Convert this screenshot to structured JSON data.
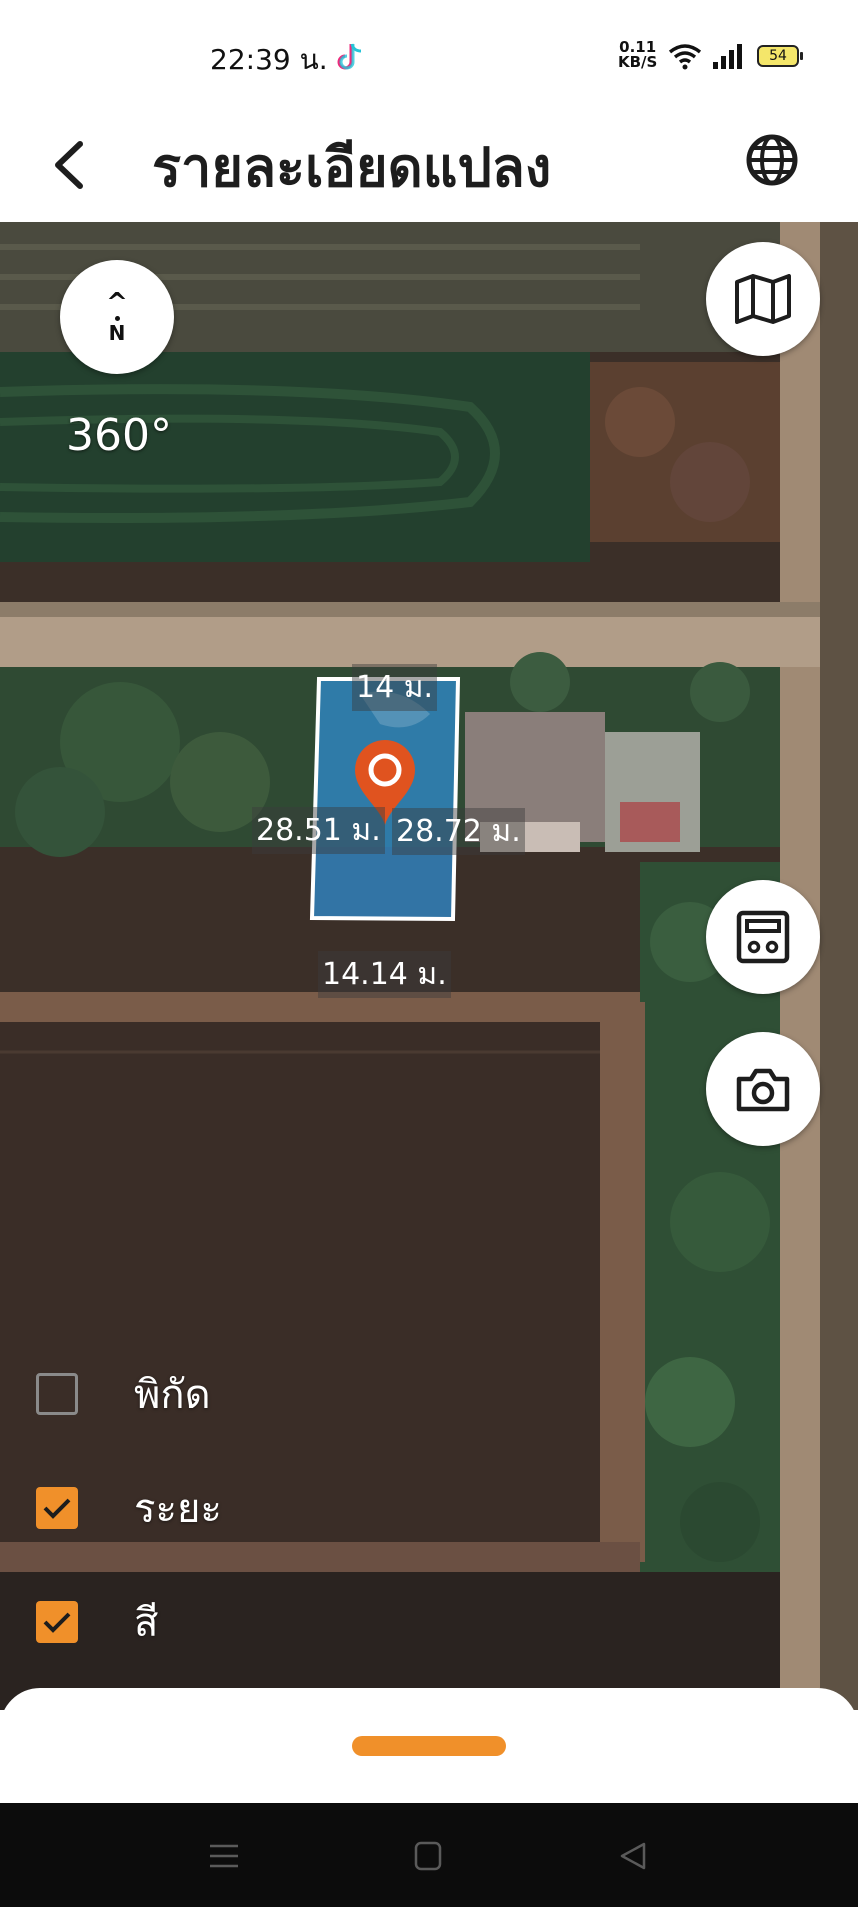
{
  "status_bar": {
    "time": "22:39 น.",
    "net_speed": "0.11",
    "net_unit": "KB/S",
    "battery": "54",
    "app_icon": "tiktok-icon",
    "wifi_icon": "wifi-icon",
    "signal_icon": "signal-icon"
  },
  "header": {
    "title": "รายละเอียดแปลง",
    "back_icon": "chevron-left-icon",
    "globe_icon": "globe-icon"
  },
  "map": {
    "compass": {
      "arrow": "^",
      "north": "N"
    },
    "heading": "360°",
    "buttons": {
      "map_type_icon": "map-icon",
      "calculator_icon": "calculator-icon",
      "camera_icon": "camera-icon"
    },
    "plot": {
      "fill_color": "#2f8fd6",
      "border_color": "#ffffff",
      "pin_color": "#e0531f",
      "top_length": "14 ม.",
      "left_length": "28.51 ม.",
      "right_length": "28.72 ม.",
      "bottom_length": "14.14 ม."
    }
  },
  "layers": [
    {
      "label": "พิกัด",
      "checked": false
    },
    {
      "label": "ระยะ",
      "checked": true
    },
    {
      "label": "สี",
      "checked": true
    }
  ],
  "accent_color": "#f0902a",
  "nav_bar": {
    "menu_icon": "menu-icon",
    "home_icon": "home-square-icon",
    "back_icon": "back-triangle-icon"
  }
}
